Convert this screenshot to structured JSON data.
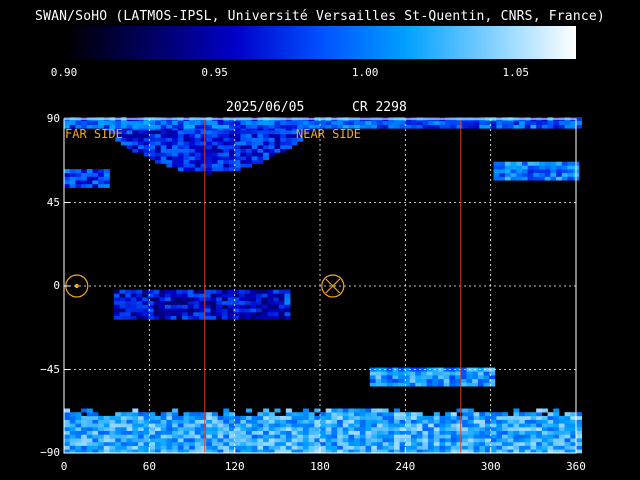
{
  "header": {
    "title": "SWAN/SoHO (LATMOS-IPSL, Université Versailles St-Quentin, CNRS, France)",
    "date": "2025/06/05",
    "rotation": "CR 2298"
  },
  "colorbar": {
    "min": 0.9,
    "max": 1.07,
    "ticks": [
      "0.90",
      "0.95",
      "1.00",
      "1.05"
    ],
    "tick_values": [
      0.9,
      0.95,
      1.0,
      1.05
    ],
    "colors": [
      "#000000",
      "#000060",
      "#0000c8",
      "#0050ff",
      "#00a0ff",
      "#80d0ff",
      "#ffffff"
    ]
  },
  "labels": {
    "far_side": "FAR SIDE",
    "near_side": "NEAR SIDE"
  },
  "chart_data": {
    "type": "heatmap",
    "xlim": [
      0,
      360
    ],
    "ylim": [
      -90,
      90
    ],
    "x_ticks": [
      "0",
      "60",
      "120",
      "180",
      "240",
      "300",
      "360"
    ],
    "y_ticks": [
      "90",
      "45",
      "0",
      "−45",
      "−90"
    ],
    "y_tick_values": [
      90,
      45,
      0,
      -45,
      -90
    ],
    "grid": true,
    "vertical_markers_x": [
      99,
      279
    ],
    "marker_color": "#e04020",
    "far_side_center": {
      "x": 9,
      "y": 0
    },
    "near_side_center": {
      "x": 189,
      "y": 0
    },
    "regions": [
      {
        "name": "north-polar-cap",
        "x0": 20,
        "x1": 180,
        "y0": 60,
        "y1": 88,
        "level": 0.97
      },
      {
        "name": "north-edge-strip",
        "x0": 0,
        "x1": 360,
        "y0": 85,
        "y1": 90,
        "level": 0.99
      },
      {
        "name": "north-left-patch",
        "x0": 0,
        "x1": 28,
        "y0": 53,
        "y1": 63,
        "level": 0.98
      },
      {
        "name": "north-right-strip",
        "x0": 302,
        "x1": 360,
        "y0": 57,
        "y1": 66,
        "level": 1.0
      },
      {
        "name": "equator-band",
        "x0": 35,
        "x1": 155,
        "y0": -18,
        "y1": -3,
        "level": 0.96
      },
      {
        "name": "equator-band-right",
        "x0": 155,
        "x1": 155,
        "y0": -10,
        "y1": -3,
        "level": 0.98
      },
      {
        "name": "south-strip",
        "x0": 215,
        "x1": 302,
        "y0": -54,
        "y1": -45,
        "level": 1.01
      },
      {
        "name": "south-polar-band",
        "x0": 0,
        "x1": 360,
        "y0": -90,
        "y1": -67,
        "level": 1.02
      }
    ]
  }
}
